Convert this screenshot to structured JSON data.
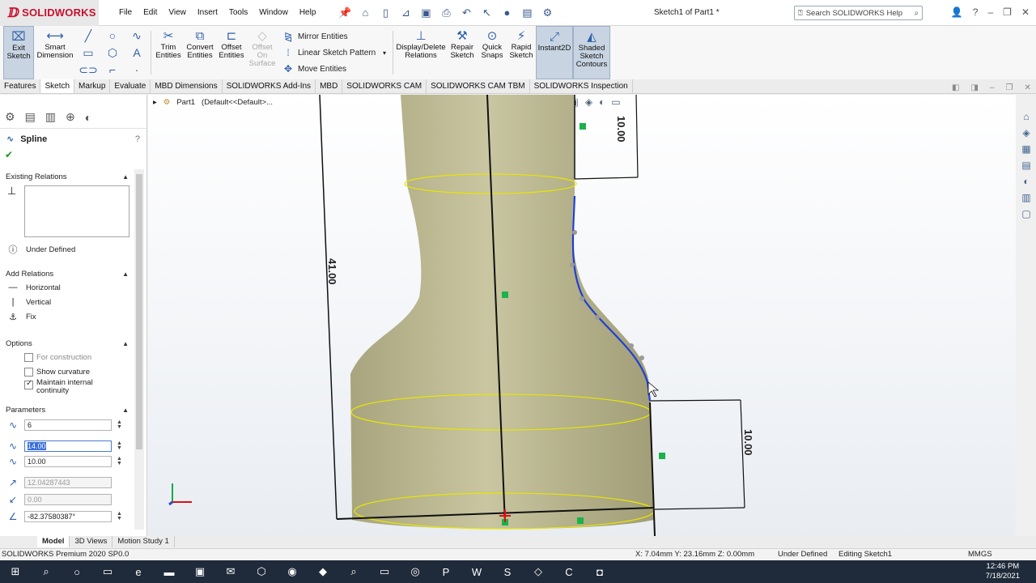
{
  "app": {
    "brand": "SOLIDWORKS",
    "menu": [
      "File",
      "Edit",
      "View",
      "Insert",
      "Tools",
      "Window",
      "Help"
    ],
    "doc_title": "Sketch1 of Part1 *",
    "search_placeholder": "Search SOLIDWORKS Help",
    "accent_red": "#c8102e",
    "accent_blue": "#2f5fa8"
  },
  "commands": {
    "exit_sketch": "Exit Sketch",
    "smart_dimension": "Smart Dimension",
    "trim": "Trim Entities",
    "convert": "Convert Entities",
    "offset": "Offset Entities",
    "offset_surface": "Offset On Surface",
    "mirror": "Mirror Entities",
    "linear_pattern": "Linear Sketch Pattern",
    "move": "Move Entities",
    "display_delete": "Display/Delete Relations",
    "repair": "Repair Sketch",
    "quick_snaps": "Quick Snaps",
    "rapid_sketch": "Rapid Sketch",
    "instant2d": "Instant2D",
    "shaded": "Shaded Sketch Contours"
  },
  "tabs": [
    "Features",
    "Sketch",
    "Markup",
    "Evaluate",
    "MBD Dimensions",
    "SOLIDWORKS Add-Ins",
    "MBD",
    "SOLIDWORKS CAM",
    "SOLIDWORKS CAM TBM",
    "SOLIDWORKS Inspection"
  ],
  "active_tab": "Sketch",
  "pm": {
    "title": "Spline",
    "existing_relations": "Existing Relations",
    "under_defined": "Under Defined",
    "add_relations": "Add Relations",
    "relations": [
      "Horizontal",
      "Vertical",
      "Fix"
    ],
    "options": "Options",
    "for_construction": "For construction",
    "show_curvature": "Show curvature",
    "maintain_continuity": "Maintain internal continuity",
    "parameters": "Parameters",
    "p1": "6",
    "p2": "14.00",
    "p3": "10.00",
    "p4": "12.04287443",
    "p5": "0.00",
    "p6": "-82.37580387°"
  },
  "tree": {
    "part": "Part1",
    "config": "(Default<<Default>..."
  },
  "dimensions": {
    "top_right": "10.00",
    "left": "41.00",
    "bottom_right": "10.00"
  },
  "bottom_tabs": [
    "Model",
    "3D Views",
    "Motion Study 1"
  ],
  "status": {
    "product": "SOLIDWORKS Premium 2020 SP0.0",
    "coords": "X: 7.04mm Y: 23.16mm Z: 0.00mm",
    "state": "Under Defined",
    "editing": "Editing Sketch1",
    "units": "MMGS"
  },
  "clock": {
    "time": "12:46 PM",
    "date": "7/18/2021"
  }
}
